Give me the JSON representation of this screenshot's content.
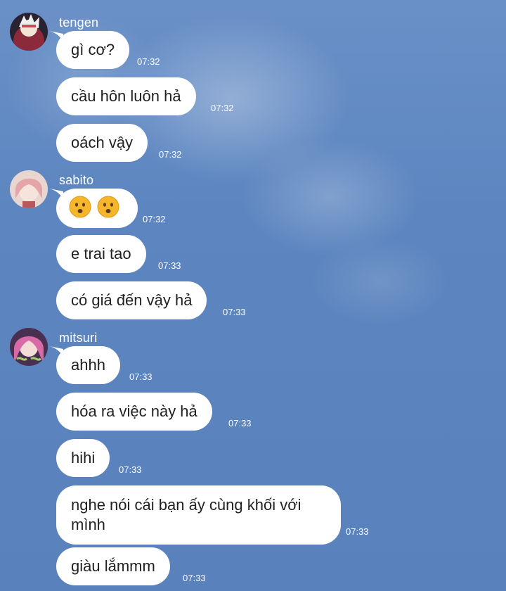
{
  "senders": {
    "tengen": {
      "name": "tengen"
    },
    "sabito": {
      "name": "sabito"
    },
    "mitsuri": {
      "name": "mitsuri"
    }
  },
  "messages": [
    {
      "text": "gì cơ?",
      "time": "07:32"
    },
    {
      "text": "cầu hôn luôn hả",
      "time": "07:32"
    },
    {
      "text": "oách vậy",
      "time": "07:32"
    },
    {
      "emoji": [
        "frowning-face-emoji",
        "frowning-face-emoji"
      ],
      "time": "07:32"
    },
    {
      "text": "e trai tao",
      "time": "07:33"
    },
    {
      "text": "có giá đến vậy hả",
      "time": "07:33"
    },
    {
      "text": "ahhh",
      "time": "07:33"
    },
    {
      "text": "hóa ra việc này hả",
      "time": "07:33"
    },
    {
      "text": "hihi",
      "time": "07:33"
    },
    {
      "text": "nghe nói cái bạn ấy cùng khối với mình",
      "time": "07:33"
    },
    {
      "text": "giàu lắmmm",
      "time": "07:33"
    }
  ],
  "colors": {
    "background": "#5b84bf",
    "bubble": "#ffffff",
    "text": "#222222"
  }
}
